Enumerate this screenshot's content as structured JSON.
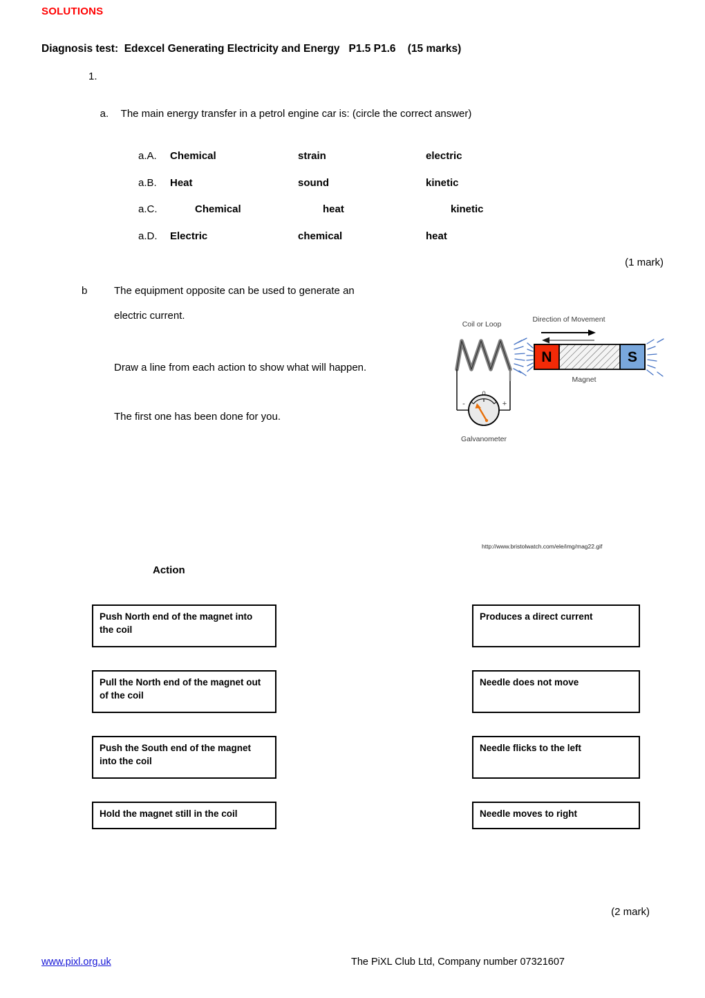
{
  "document": {
    "solutions_label": "SOLUTIONS",
    "diagnosis_heading": "Diagnosis test:  Edexcel Generating Electricity and Energy   P1.5 P1.6    (15 marks)"
  },
  "question1": {
    "number": "1.",
    "part_a_label": "a.",
    "part_a_text": "The main energy transfer in a petrol engine car is: (circle the correct answer)",
    "options": [
      {
        "key": "a.A.",
        "col1": "Chemical",
        "col2": "strain",
        "col3": "electric"
      },
      {
        "key": "a.B.",
        "col1": "Heat",
        "col2": "sound",
        "col3": "kinetic"
      },
      {
        "key": "a.C.",
        "col1": "Chemical",
        "col2": "heat",
        "col3": "kinetic"
      },
      {
        "key": "a.D.",
        "col1": "Electric",
        "col2": "chemical",
        "col3": "heat"
      }
    ],
    "marks_a": "(1 mark)",
    "part_b_label": "b",
    "part_b_line1": "The equipment opposite can be used to generate an",
    "part_b_line2": "electric current.",
    "part_b_line3": "Draw a line from each action to show what will happen.",
    "part_b_line4": "The first one has been done for you.",
    "marks_b": "(2 mark)"
  },
  "diagram": {
    "coil_label": "Coil or Loop",
    "direction_label": "Direction of Movement",
    "magnet_label": "Magnet",
    "north_pole": "N",
    "south_pole": "S",
    "galvanometer_label": "Galvanometer",
    "gauge_zero": "0",
    "gauge_minus": "-",
    "gauge_plus": "+",
    "image_credit": "http://www.bristolwatch.com/ele/img/mag22.gif",
    "colors": {
      "north_pole_fill": "#f32a07",
      "south_pole_fill": "#79a7dc",
      "coil_stroke": "#7f7f7f",
      "field_lines": "#4472c4",
      "needle": "#e8700a",
      "gauge_face": "#eaeaea"
    }
  },
  "matching": {
    "action_heading": "Action",
    "actions": [
      "Push North end of the magnet into the coil",
      "Pull the North end of the magnet out of the coil",
      "Push the South end of the magnet into the coil",
      "Hold the magnet still in the coil"
    ],
    "outcomes": [
      "Produces a direct current",
      "Needle does not move",
      "Needle flicks to the left",
      "Needle moves to right"
    ]
  },
  "footer": {
    "website": "www.pixl.org.uk",
    "company": "The PiXL Club Ltd, Company number 07321607"
  }
}
